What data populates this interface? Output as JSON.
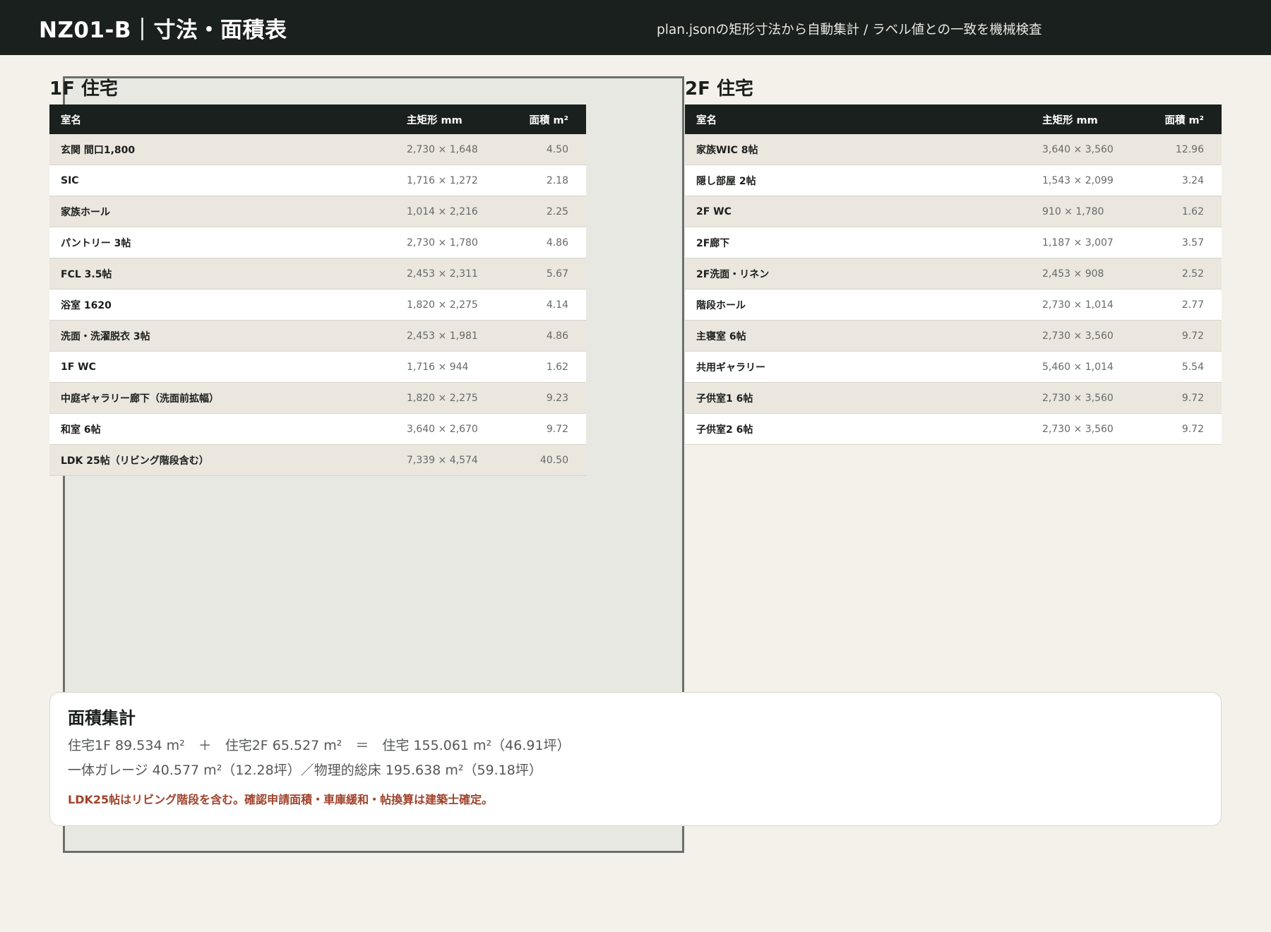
{
  "header": {
    "title": "NZ01-B｜寸法・面積表",
    "subtitle": "plan.jsonの矩形寸法から自動集計 / ラベル値との一致を機械検査"
  },
  "columns": {
    "name": "室名",
    "dims": "主矩形 mm",
    "area": "面積 m²"
  },
  "floor1": {
    "title": "1F 住宅",
    "rows": [
      {
        "name": "玄関 間口1,800",
        "dims": "2,730 × 1,648",
        "area": "4.50"
      },
      {
        "name": "SIC",
        "dims": "1,716 × 1,272",
        "area": "2.18"
      },
      {
        "name": "家族ホール",
        "dims": "1,014 × 2,216",
        "area": "2.25"
      },
      {
        "name": "パントリー 3帖",
        "dims": "2,730 × 1,780",
        "area": "4.86"
      },
      {
        "name": "FCL 3.5帖",
        "dims": "2,453 × 2,311",
        "area": "5.67"
      },
      {
        "name": "浴室 1620",
        "dims": "1,820 × 2,275",
        "area": "4.14"
      },
      {
        "name": "洗面・洗濯脱衣 3帖",
        "dims": "2,453 × 1,981",
        "area": "4.86"
      },
      {
        "name": "1F WC",
        "dims": "1,716 × 944",
        "area": "1.62"
      },
      {
        "name": "中庭ギャラリー廊下（洗面前拡幅）",
        "dims": "1,820 × 2,275",
        "area": "9.23"
      },
      {
        "name": "和室 6帖",
        "dims": "3,640 × 2,670",
        "area": "9.72"
      },
      {
        "name": "LDK 25帖（リビング階段含む）",
        "dims": "7,339 × 4,574",
        "area": "40.50"
      }
    ]
  },
  "floor2": {
    "title": "2F 住宅",
    "rows": [
      {
        "name": "家族WIC 8帖",
        "dims": "3,640 × 3,560",
        "area": "12.96"
      },
      {
        "name": "隠し部屋 2帖",
        "dims": "1,543 × 2,099",
        "area": "3.24"
      },
      {
        "name": "2F WC",
        "dims": "910 × 1,780",
        "area": "1.62"
      },
      {
        "name": "2F廊下",
        "dims": "1,187 × 3,007",
        "area": "3.57"
      },
      {
        "name": "2F洗面・リネン",
        "dims": "2,453 × 908",
        "area": "2.52"
      },
      {
        "name": "階段ホール",
        "dims": "2,730 × 1,014",
        "area": "2.77"
      },
      {
        "name": "主寝室 6帖",
        "dims": "2,730 × 3,560",
        "area": "9.72"
      },
      {
        "name": "共用ギャラリー",
        "dims": "5,460 × 1,014",
        "area": "5.54"
      },
      {
        "name": "子供室1 6帖",
        "dims": "2,730 × 3,560",
        "area": "9.72"
      },
      {
        "name": "子供室2 6帖",
        "dims": "2,730 × 3,560",
        "area": "9.72"
      }
    ]
  },
  "summary": {
    "title": "面積集計",
    "line1": "住宅1F 89.534 m²　＋　住宅2F 65.527 m²　＝　住宅 155.061 m²（46.91坪）",
    "line2": "一体ガレージ 40.577 m²（12.28坪）／物理的総床 195.638 m²（59.18坪）",
    "note": "LDK25帖はリビング階段を含む。確認申請面積・車庫緩和・帖換算は建築士確定。"
  },
  "colors": {
    "header_bg": "#1a201d",
    "page_bg": "#f4f1ea",
    "row_alt": "#ebe6de",
    "note": "#a0432c"
  }
}
